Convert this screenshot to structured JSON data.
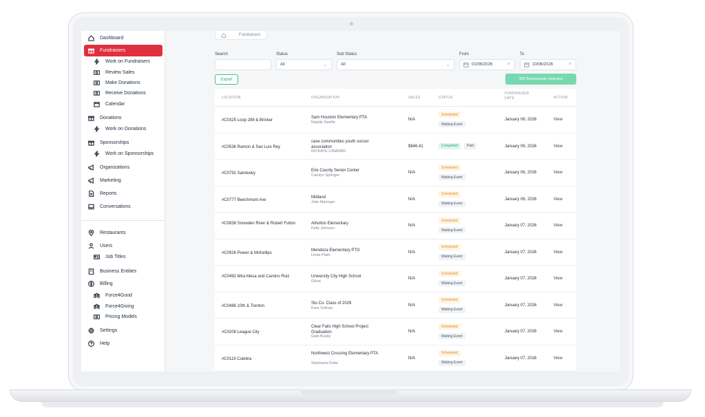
{
  "sidebar": {
    "items": [
      {
        "label": "Dashboard",
        "icon": "home-icon"
      },
      {
        "label": "Fundraisers",
        "icon": "gift-icon"
      },
      {
        "label": "Work on Fundraisers",
        "icon": "bolt-icon"
      },
      {
        "label": "Review Sales",
        "icon": "money-icon"
      },
      {
        "label": "Make Donations",
        "icon": "money-icon"
      },
      {
        "label": "Receive Donations",
        "icon": "money-icon"
      },
      {
        "label": "Calendar",
        "icon": "calendar-icon"
      },
      {
        "label": "Donations",
        "icon": "gift-icon"
      },
      {
        "label": "Work on Donations",
        "icon": "bolt-icon"
      },
      {
        "label": "Sponsorships",
        "icon": "gift-icon"
      },
      {
        "label": "Work on Sponsorships",
        "icon": "bolt-icon"
      },
      {
        "label": "Organizations",
        "icon": "megaphone-icon"
      },
      {
        "label": "Marketing",
        "icon": "megaphone-icon"
      },
      {
        "label": "Reports",
        "icon": "file-icon"
      },
      {
        "label": "Conversations",
        "icon": "inbox-icon"
      },
      {
        "label": "Restaurants",
        "icon": "pin-icon"
      },
      {
        "label": "Users",
        "icon": "user-icon"
      },
      {
        "label": "Job Titles",
        "icon": "id-card-icon"
      },
      {
        "label": "Business Entities",
        "icon": "building-icon"
      },
      {
        "label": "Billing",
        "icon": "dollar-icon"
      },
      {
        "label": "Force4Good",
        "icon": "group-icon"
      },
      {
        "label": "Force4Giving",
        "icon": "group-icon"
      },
      {
        "label": "Pricing Models",
        "icon": "money-icon"
      },
      {
        "label": "Settings",
        "icon": "gear-icon"
      },
      {
        "label": "Help",
        "icon": "help-icon"
      }
    ],
    "active_color": "#e0303f"
  },
  "breadcrumb": {
    "current": "Fundraisers"
  },
  "filters": {
    "search_label": "Search",
    "search_value": "",
    "status_label": "Status",
    "status_value": "All",
    "substatus_label": "Sub Status",
    "substatus_value": "All",
    "from_label": "From",
    "from_value": "01/06/2026",
    "to_label": "To",
    "to_value": "10/06/2026"
  },
  "actions": {
    "export_label": "Export",
    "selected_label": "962 Restaurants Selected"
  },
  "table": {
    "headers": [
      "LOCATION",
      "ORGANIZATION",
      "SALES",
      "STATUS",
      "FUNDRAISER DATE",
      "ACTION"
    ],
    "rows": [
      {
        "location": "#C0325 Loop 288 & Brinker",
        "org": "Sam Houston Elementary PTA",
        "contact": "Natalie Saville",
        "sales": "N/A",
        "status": "Scheduled",
        "sub": "Waiting Event",
        "date": "January 06, 2026",
        "action": "View"
      },
      {
        "location": "#C0536 Ramon & San Luis Rey",
        "org": "cave communities youth soccer association",
        "contact": "RICKAYE CINADER",
        "sales": "$846.41",
        "status": "Completed",
        "sub": "Paid",
        "date": "January 06, 2026",
        "action": "View"
      },
      {
        "location": "#C0791 Sandusky",
        "org": "Erie County Senior Center",
        "contact": "Carolyn Springer",
        "sales": "N/A",
        "status": "Scheduled",
        "sub": "Waiting Event",
        "date": "January 06, 2026",
        "action": "View"
      },
      {
        "location": "#C0777 Beechmont Ave",
        "org": "Midland",
        "contact": "Julie Maringer",
        "sales": "N/A",
        "status": "Scheduled",
        "sub": "Waiting Event",
        "date": "January 06, 2026",
        "action": "View"
      },
      {
        "location": "#C0838 Snowden River & Robert Fulton",
        "org": "Atholton Elementary",
        "contact": "Kelly Johnson",
        "sales": "N/A",
        "status": "Scheduled",
        "sub": "Waiting Event",
        "date": "January 07, 2026",
        "action": "View"
      },
      {
        "location": "#C0926 Power & McKellips",
        "org": "Mendoza Elementary PTO",
        "contact": "Linda Plath",
        "sales": "N/A",
        "status": "Scheduled",
        "sub": "Waiting Event",
        "date": "January 07, 2026",
        "action": "View"
      },
      {
        "location": "#C0492 Mira Mesa and Camino Ruiz",
        "org": "University City High School",
        "contact": "Olivia",
        "sales": "N/A",
        "status": "Scheduled",
        "sub": "Waiting Event",
        "date": "January 07, 2026",
        "action": "View"
      },
      {
        "location": "#C0486 10th & Trenton",
        "org": "Stu Co. Class of 2029",
        "contact": "Kara Solinas",
        "sales": "N/A",
        "status": "Scheduled",
        "sub": "Waiting Event",
        "date": "January 07, 2026",
        "action": "View"
      },
      {
        "location": "#C0208 League City",
        "org": "Clear Falls High School Project Graduation",
        "contact": "Gabi Busby",
        "sales": "N/A",
        "status": "Scheduled",
        "sub": "Waiting Event",
        "date": "January 07, 2026",
        "action": "View"
      },
      {
        "location": "#C0119 Culebra",
        "org": "Northwest Crossing Elementary PTA",
        "contact": "Stephanie Enbe",
        "sales": "N/A",
        "status": "Scheduled",
        "sub": "Waiting Event",
        "date": "January 07, 2026",
        "action": "View"
      }
    ]
  }
}
